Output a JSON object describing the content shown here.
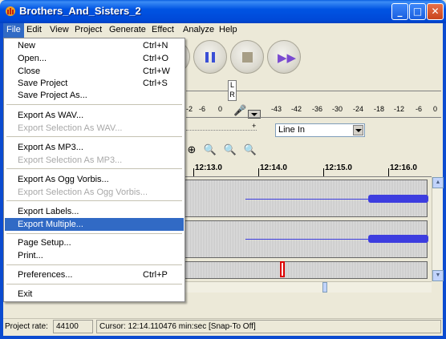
{
  "window": {
    "title": "Brothers_And_Sisters_2",
    "minimize_glyph": "_",
    "maximize_glyph": "□",
    "close_glyph": "✕"
  },
  "menubar": {
    "items": [
      "File",
      "Edit",
      "View",
      "Project",
      "Generate",
      "Effect",
      "Analyze",
      "Help"
    ],
    "active": "File"
  },
  "file_menu": {
    "groups": [
      [
        {
          "label": "New",
          "shortcut": "Ctrl+N",
          "enabled": true
        },
        {
          "label": "Open...",
          "shortcut": "Ctrl+O",
          "enabled": true
        },
        {
          "label": "Close",
          "shortcut": "Ctrl+W",
          "enabled": true
        },
        {
          "label": "Save Project",
          "shortcut": "Ctrl+S",
          "enabled": true
        },
        {
          "label": "Save Project As...",
          "shortcut": "",
          "enabled": true
        }
      ],
      [
        {
          "label": "Export As WAV...",
          "shortcut": "",
          "enabled": true
        },
        {
          "label": "Export Selection As WAV...",
          "shortcut": "",
          "enabled": false
        }
      ],
      [
        {
          "label": "Export As MP3...",
          "shortcut": "",
          "enabled": true
        },
        {
          "label": "Export Selection As MP3...",
          "shortcut": "",
          "enabled": false
        }
      ],
      [
        {
          "label": "Export As Ogg Vorbis...",
          "shortcut": "",
          "enabled": true
        },
        {
          "label": "Export Selection As Ogg Vorbis...",
          "shortcut": "",
          "enabled": false
        }
      ],
      [
        {
          "label": "Export Labels...",
          "shortcut": "",
          "enabled": true
        },
        {
          "label": "Export Multiple...",
          "shortcut": "",
          "enabled": true,
          "selected": true
        }
      ],
      [
        {
          "label": "Page Setup...",
          "shortcut": "",
          "enabled": true
        },
        {
          "label": "Print...",
          "shortcut": "",
          "enabled": true
        }
      ],
      [
        {
          "label": "Preferences...",
          "shortcut": "Ctrl+P",
          "enabled": true
        }
      ],
      [
        {
          "label": "Exit",
          "shortcut": "",
          "enabled": true
        }
      ]
    ]
  },
  "meter": {
    "left_channel": "L",
    "right_channel": "R",
    "ticks": [
      "-2",
      "-6",
      "0",
      "-43",
      "-42",
      "-36",
      "-30",
      "-24",
      "-18",
      "-12",
      "-6",
      "0"
    ],
    "plus_label": "+"
  },
  "input_source": {
    "selected": "Line In"
  },
  "timeline": {
    "labels": [
      "12:13.0",
      "12:14.0",
      "12:15.0",
      "12:16.0"
    ]
  },
  "statusbar": {
    "project_rate_label": "Project rate:",
    "project_rate_value": "44100",
    "cursor_text": "Cursor: 12:14.110476 min:sec   [Snap-To Off]"
  },
  "colors": {
    "titlebar": "#0054e3",
    "menu_highlight": "#316ac5",
    "waveform": "#3d3ddf"
  }
}
